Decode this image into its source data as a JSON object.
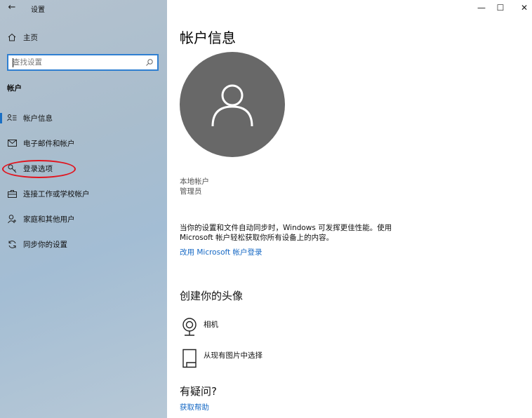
{
  "window": {
    "app_title": "设置",
    "back_icon": "←",
    "minimize_glyph": "—",
    "maximize_glyph": "☐",
    "close_glyph": "✕"
  },
  "sidebar": {
    "home_label": "主页",
    "search": {
      "placeholder": "查找设置",
      "value": ""
    },
    "section_title": "帐户",
    "items": [
      {
        "label": "帐户信息",
        "icon": "account-info-icon",
        "active": true
      },
      {
        "label": "电子邮件和帐户",
        "icon": "mail-icon",
        "active": false
      },
      {
        "label": "登录选项",
        "icon": "key-icon",
        "active": false,
        "highlighted": true
      },
      {
        "label": "连接工作或学校帐户",
        "icon": "briefcase-icon",
        "active": false
      },
      {
        "label": "家庭和其他用户",
        "icon": "person-add-icon",
        "active": false
      },
      {
        "label": "同步你的设置",
        "icon": "sync-icon",
        "active": false
      }
    ]
  },
  "main": {
    "title": "帐户信息",
    "account_type": "本地帐户",
    "account_role": "管理员",
    "description": "当你的设置和文件自动同步时，Windows 可发挥更佳性能。使用 Microsoft 帐户轻松获取你所有设备上的内容。",
    "ms_signin_link": "改用 Microsoft 帐户登录",
    "create_avatar_heading": "创建你的头像",
    "avatar_options": [
      {
        "label": "相机",
        "icon": "camera-icon"
      },
      {
        "label": "从现有图片中选择",
        "icon": "picture-file-icon"
      }
    ],
    "question_heading": "有疑问?",
    "help_link": "获取帮助"
  },
  "colors": {
    "accent": "#1568c4",
    "avatar_bg": "#686868",
    "highlight_circle": "#e1141e"
  }
}
